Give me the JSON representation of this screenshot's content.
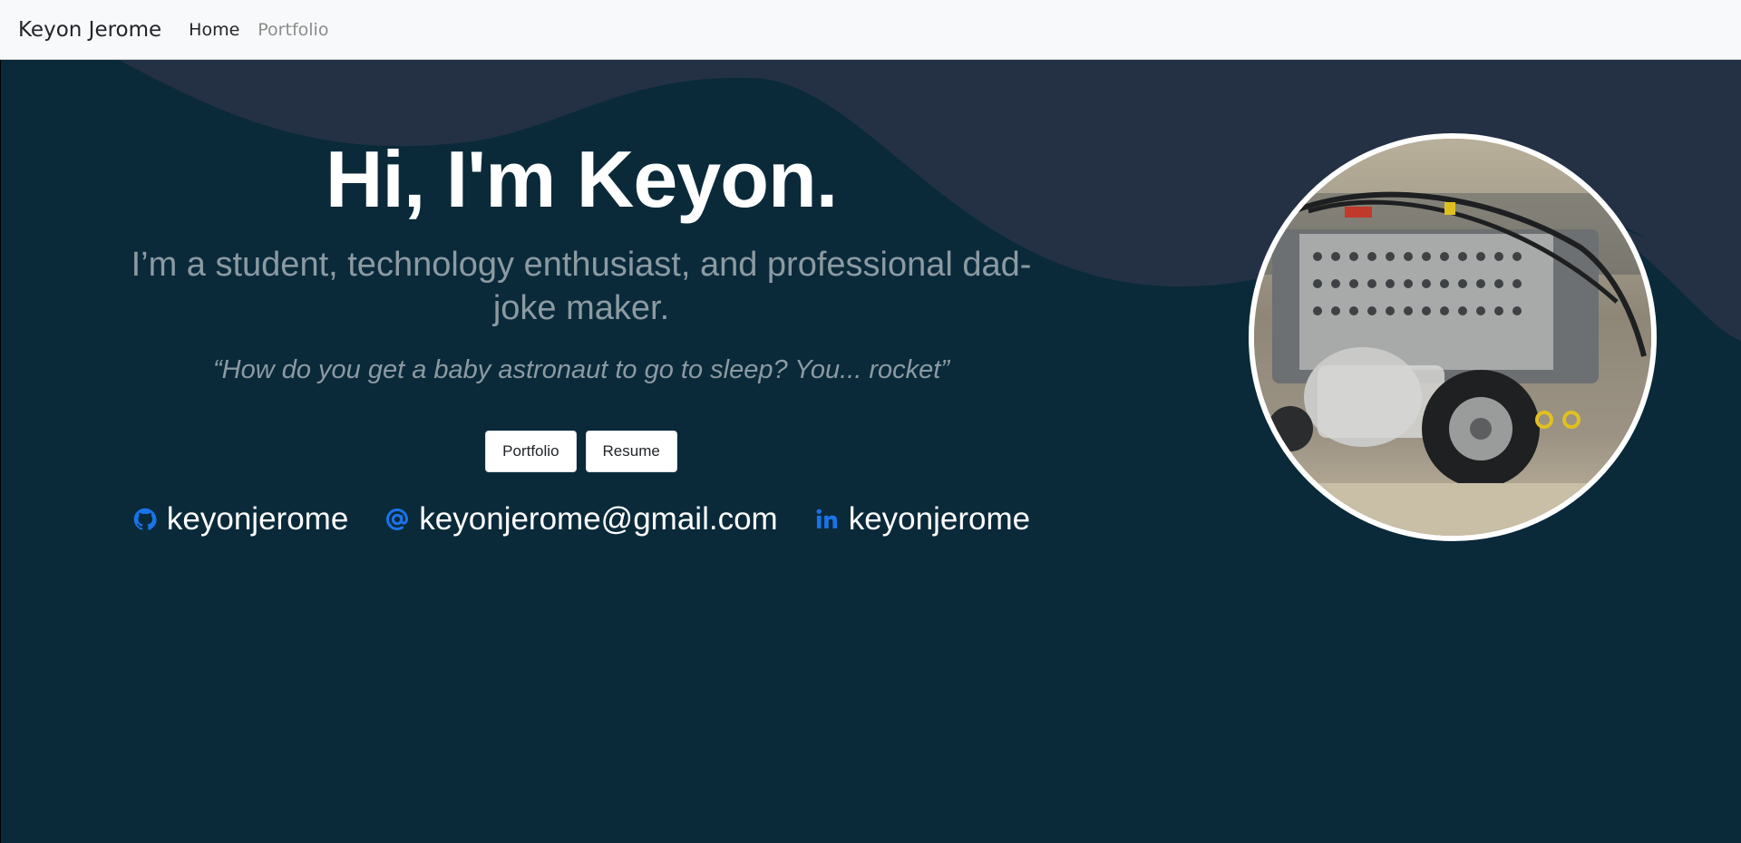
{
  "navbar": {
    "brand": "Keyon Jerome",
    "links": [
      {
        "label": "Home"
      },
      {
        "label": "Portfolio"
      }
    ]
  },
  "hero": {
    "headline": "Hi, I'm Keyon.",
    "tagline": "I’m a student, technology enthusiast, and professional dad-joke maker.",
    "joke": "“How do you get a baby astronaut to go to sleep? You... rocket”",
    "buttons": {
      "portfolio": "Portfolio",
      "resume": "Resume"
    },
    "contacts": {
      "github": {
        "icon": "github-icon",
        "label": "keyonjerome"
      },
      "email": {
        "icon": "at-icon",
        "label": "keyonjerome@gmail.com"
      },
      "linkedin": {
        "icon": "linkedin-icon",
        "label": "keyonjerome"
      }
    },
    "photo": {
      "subject": "robot-photo"
    }
  },
  "colors": {
    "navbar_bg": "#f8f9fa",
    "hero_bg": "#0a2a3a",
    "wave": "#243145",
    "muted_text": "#8c9aa2",
    "icon_accent": "#1a73e8"
  }
}
